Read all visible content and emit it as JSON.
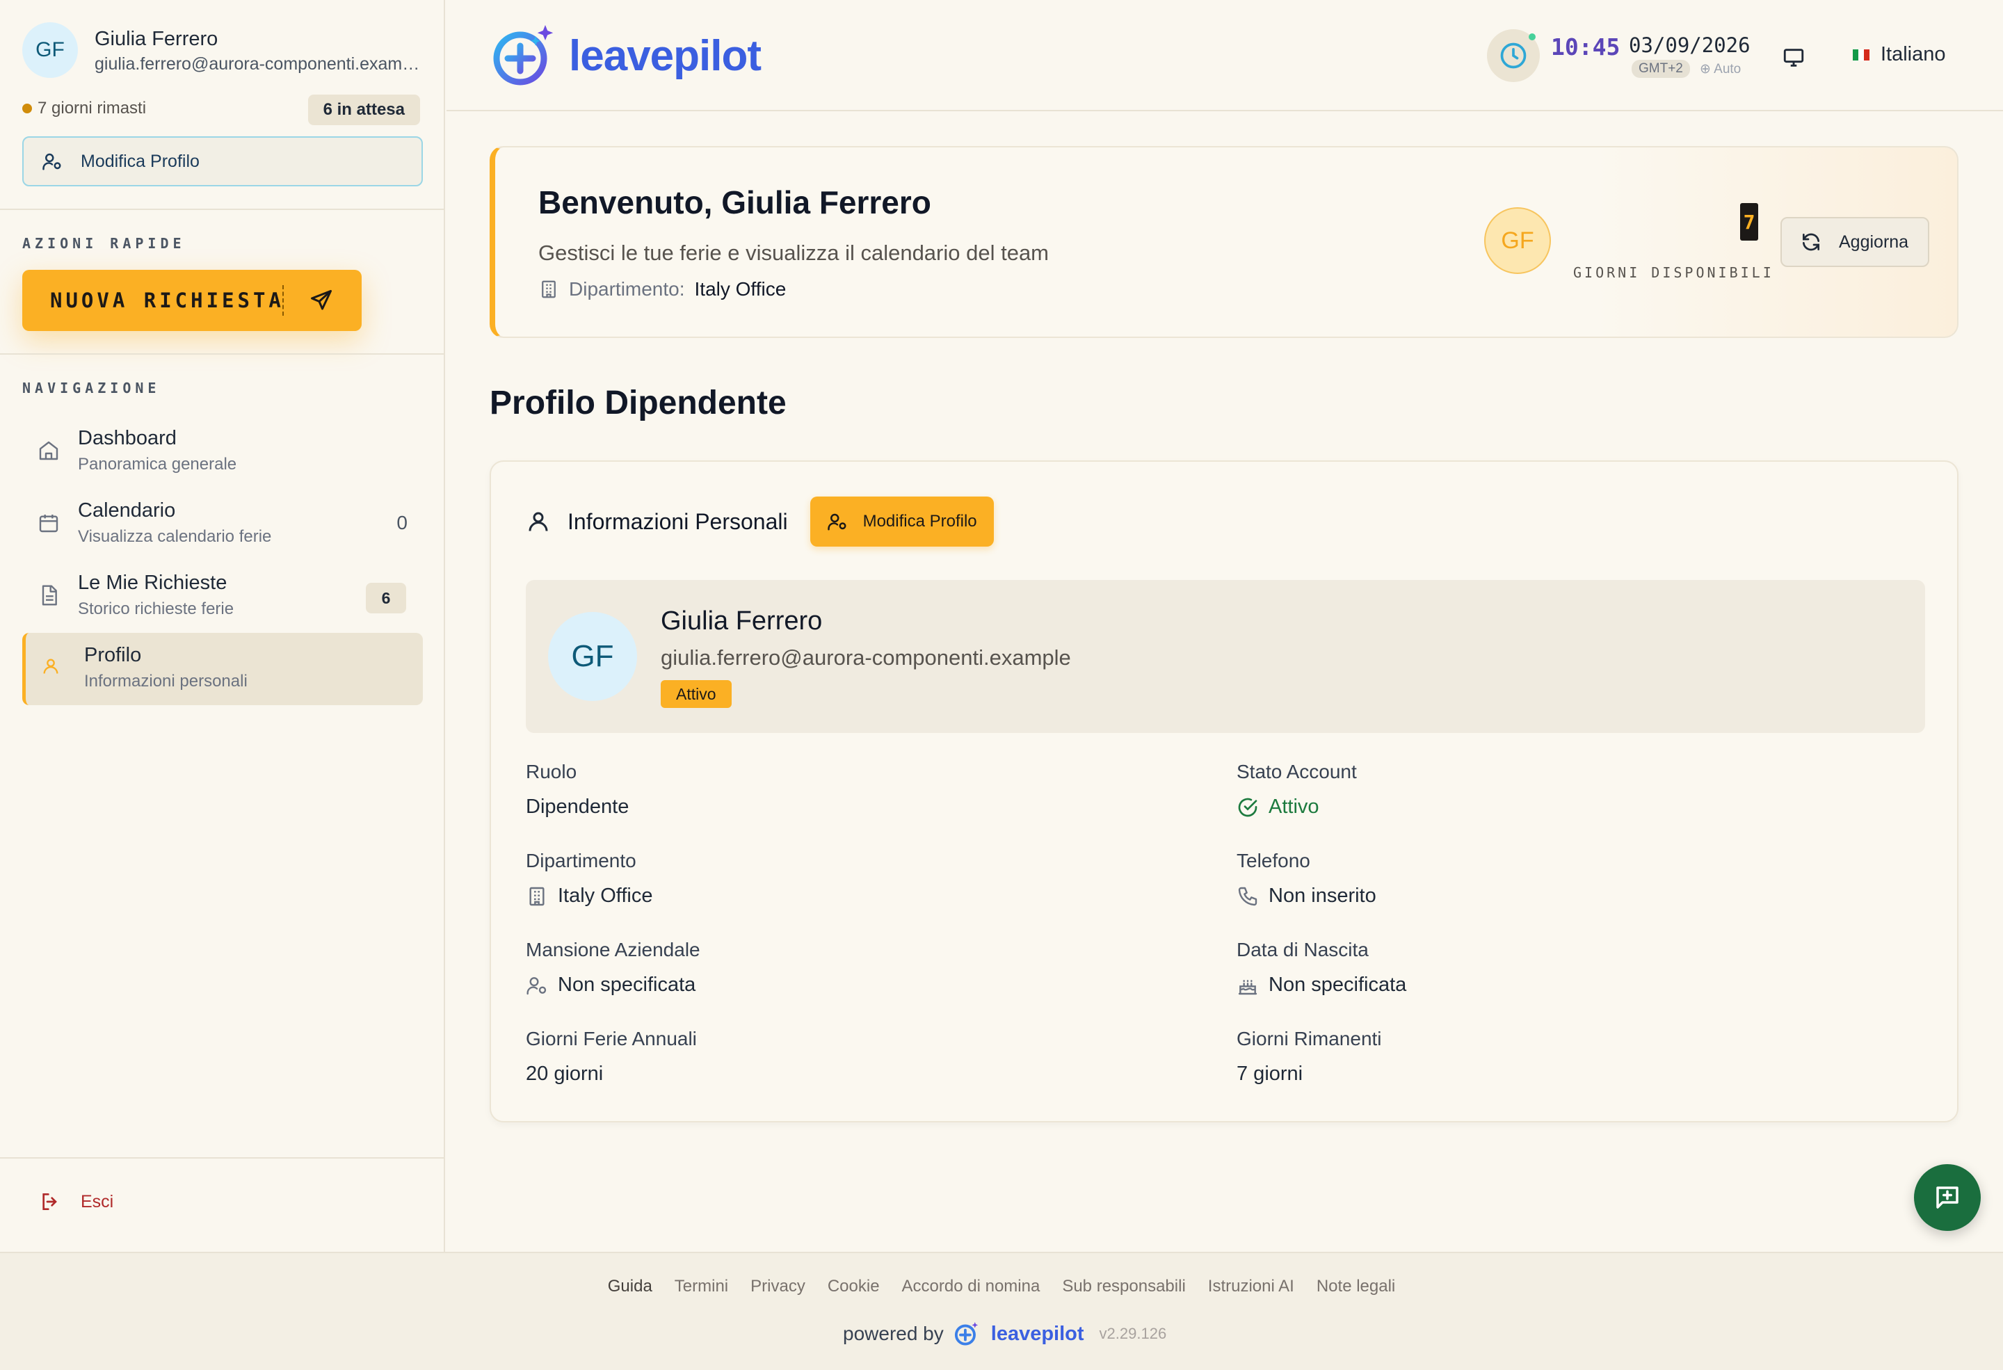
{
  "sidebar": {
    "user": {
      "initials": "GF",
      "name": "Giulia Ferrero",
      "email": "giulia.ferrero@aurora-componenti.examp...",
      "days_left": "7 giorni rimasti",
      "pending": "6 in attesa",
      "edit_profile": "Modifica Profilo"
    },
    "quick_actions_title": "AZIONI RAPIDE",
    "new_request": "NUOVA RICHIESTA",
    "nav_title": "NAVIGAZIONE",
    "nav": [
      {
        "title": "Dashboard",
        "subtitle": "Panoramica generale",
        "icon": "home-icon"
      },
      {
        "title": "Calendario",
        "subtitle": "Visualizza calendario ferie",
        "count": "0",
        "icon": "calendar-icon"
      },
      {
        "title": "Le Mie Richieste",
        "subtitle": "Storico richieste ferie",
        "badge": "6",
        "icon": "document-icon"
      },
      {
        "title": "Profilo",
        "subtitle": "Informazioni personali",
        "icon": "user-icon",
        "active": true
      }
    ],
    "logout": "Esci"
  },
  "header": {
    "logo": "leavepilot",
    "time": "10:45",
    "date": "03/09/2026",
    "timezone": "GMT+2",
    "auto": "Auto",
    "language": "Italiano"
  },
  "welcome": {
    "title": "Benvenuto, Giulia Ferrero",
    "subtitle": "Gestisci le tue ferie e visualizza il calendario del team",
    "department_label": "Dipartimento:",
    "department": "Italy Office",
    "initials": "GF",
    "days_available": "7",
    "days_label": "GIORNI DISPONIBILI",
    "refresh": "Aggiorna"
  },
  "page_title": "Profilo Dipendente",
  "profile": {
    "section_title": "Informazioni Personali",
    "edit_button": "Modifica Profilo",
    "initials": "GF",
    "name": "Giulia Ferrero",
    "email": "giulia.ferrero@aurora-componenti.example",
    "status_badge": "Attivo",
    "fields": {
      "role_label": "Ruolo",
      "role": "Dipendente",
      "account_label": "Stato Account",
      "account": "Attivo",
      "department_label": "Dipartimento",
      "department": "Italy Office",
      "phone_label": "Telefono",
      "phone": "Non inserito",
      "job_label": "Mansione Aziendale",
      "job": "Non specificata",
      "birth_label": "Data di Nascita",
      "birth": "Non specificata",
      "annual_label": "Giorni Ferie Annuali",
      "annual": "20 giorni",
      "remaining_label": "Giorni Rimanenti",
      "remaining": "7 giorni"
    }
  },
  "footer": {
    "links": [
      "Guida",
      "Termini",
      "Privacy",
      "Cookie",
      "Accordo di nomina",
      "Sub responsabili",
      "Istruzioni AI",
      "Note legali"
    ],
    "powered_by": "powered by",
    "logo": "leavepilot",
    "version": "v2.29.126"
  },
  "colors": {
    "accent": "#fbb024",
    "brand_blue": "#3b5fe0",
    "success": "#1c7a3e",
    "chat_fab": "#1a6e3e"
  }
}
